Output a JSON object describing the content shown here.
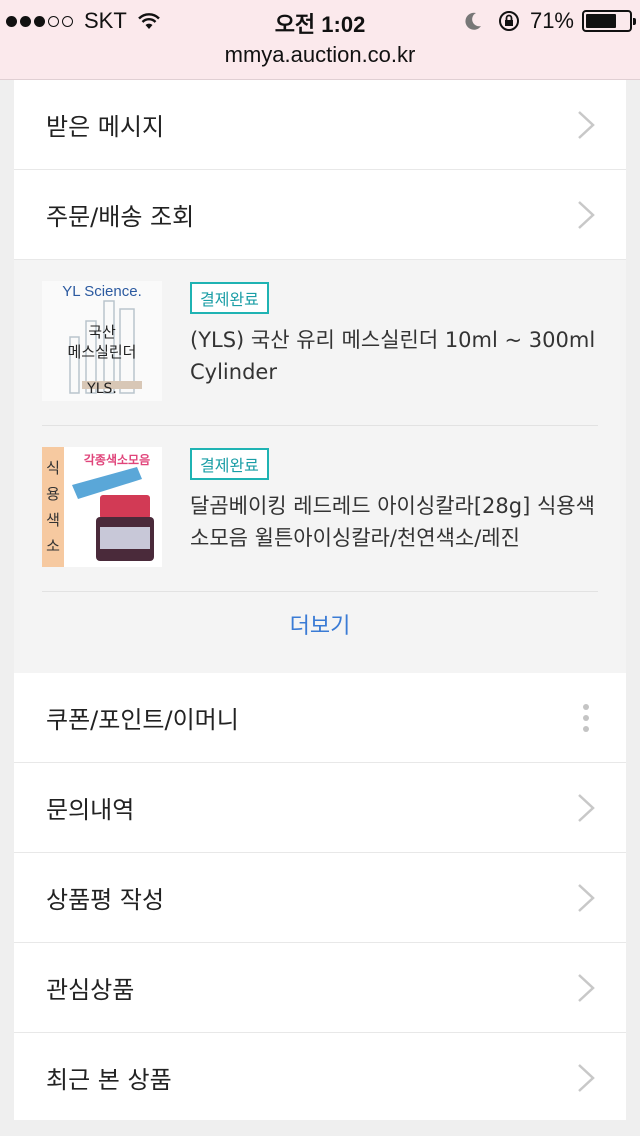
{
  "status_bar": {
    "carrier": "SKT",
    "time": "오전 1:02",
    "battery_percent": "71%",
    "battery_level": 0.71,
    "signal_bars_filled": 3,
    "signal_bars_total": 5
  },
  "url_bar": {
    "url": "mmya.auction.co.kr"
  },
  "menu_top": [
    {
      "label": "받은 메시지"
    },
    {
      "label": "주문/배송 조회"
    }
  ],
  "orders": [
    {
      "status": "결제완료",
      "title": "(YLS) 국산 유리 메스실린더 10ml ~ 300ml Cylinder",
      "thumb": {
        "brand": "YL Science.",
        "line1": "국산",
        "line2": "메스실린더",
        "line3": "YLS."
      }
    },
    {
      "status": "결제완료",
      "title": "달곰베이킹 레드레드 아이싱칼라[28g] 식용색소모음 윌튼아이싱칼라/천연색소/레진",
      "thumb": {
        "side_label": "식용색소",
        "banner": "각종색소모음"
      }
    }
  ],
  "more_label": "더보기",
  "menu_bottom": [
    {
      "label": "쿠폰/포인트/이머니",
      "icon": "more-vertical-icon"
    },
    {
      "label": "문의내역",
      "icon": "chevron-right-icon"
    },
    {
      "label": "상품평 작성",
      "icon": "chevron-right-icon"
    },
    {
      "label": "관심상품",
      "icon": "chevron-right-icon"
    },
    {
      "label": "최근 본 상품",
      "icon": "chevron-right-icon"
    }
  ],
  "colors": {
    "status_bar_bg": "#fbe9ec",
    "badge_border": "#1fb3b3",
    "link": "#3a7bd5"
  }
}
